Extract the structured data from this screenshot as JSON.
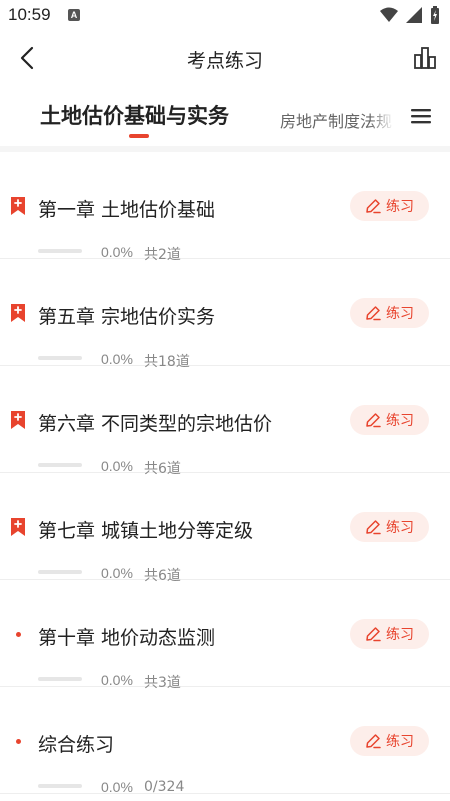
{
  "status_bar": {
    "time": "10:59",
    "notification_badge": "A",
    "icons": [
      "wifi-icon",
      "signal-icon",
      "battery-charging-icon"
    ]
  },
  "nav": {
    "title": "考点练习",
    "back_icon": "back-arrow-icon",
    "right_icon": "stats-chart-icon"
  },
  "tabs": {
    "active": "土地估价基础与实务",
    "inactive": "房地产制度法规",
    "menu_icon": "menu-icon"
  },
  "colors": {
    "accent": "#e8442e",
    "accent_bg": "#fdeeea"
  },
  "items": [
    {
      "icon": "bookmark-plus-icon",
      "title": "第一章 土地估价基础",
      "button": "练习",
      "percent": "0.0%",
      "progress": 0,
      "count": "共2道"
    },
    {
      "icon": "bookmark-plus-icon",
      "title": "第五章 宗地估价实务",
      "button": "练习",
      "percent": "0.0%",
      "progress": 0,
      "count": "共18道"
    },
    {
      "icon": "bookmark-plus-icon",
      "title": "第六章 不同类型的宗地估价",
      "button": "练习",
      "percent": "0.0%",
      "progress": 0,
      "count": "共6道"
    },
    {
      "icon": "bookmark-plus-icon",
      "title": "第七章 城镇土地分等定级",
      "button": "练习",
      "percent": "0.0%",
      "progress": 0,
      "count": "共6道"
    },
    {
      "icon": "dot",
      "title": "第十章 地价动态监测",
      "button": "练习",
      "percent": "0.0%",
      "progress": 0,
      "count": "共3道"
    },
    {
      "icon": "dot",
      "title": "综合练习",
      "button": "练习",
      "percent": "0.0%",
      "progress": 0,
      "count": "0/324"
    }
  ]
}
